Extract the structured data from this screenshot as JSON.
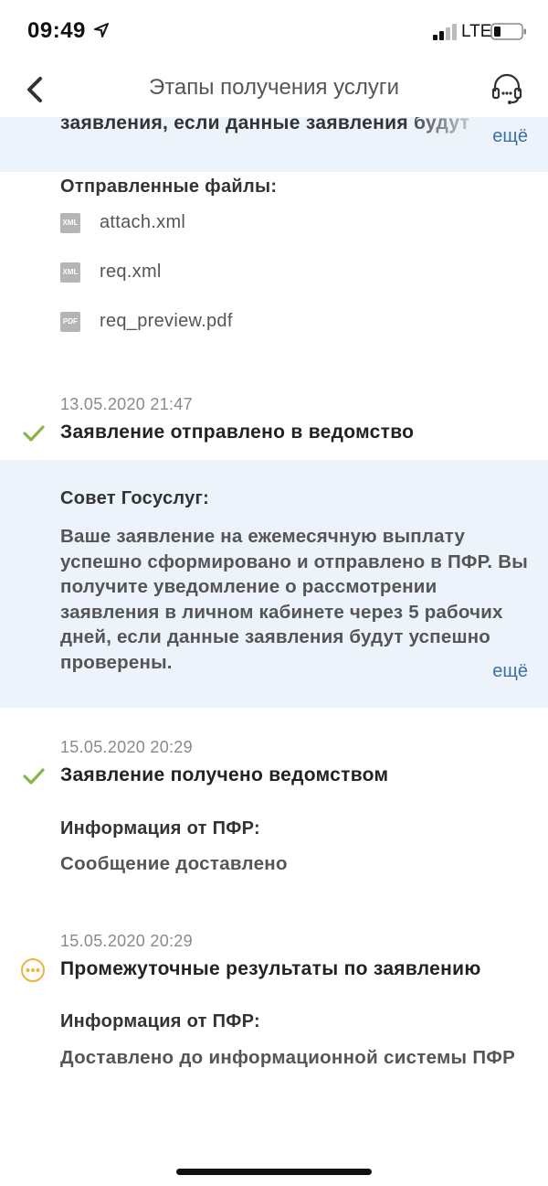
{
  "status_bar": {
    "time": "09:49",
    "network": "LTE"
  },
  "nav": {
    "title": "Этапы получения услуги",
    "back_icon": "chevron-left-icon",
    "support_icon": "headset-icon"
  },
  "top_panel": {
    "text": "заявления, если данные заявления будут",
    "more": "ещё"
  },
  "sent_files": {
    "label": "Отправленные файлы:",
    "files": [
      {
        "type": "XML",
        "name": "attach.xml"
      },
      {
        "type": "XML",
        "name": "req.xml"
      },
      {
        "type": "PDF",
        "name": "req_preview.pdf"
      }
    ]
  },
  "steps": [
    {
      "date": "13.05.2020 21:47",
      "title": "Заявление отправлено в ведомство",
      "status_icon": "check-icon"
    },
    {
      "date": "15.05.2020 20:29",
      "title": "Заявление получено ведомством",
      "status_icon": "check-icon",
      "info_label": "Информация от ПФР:",
      "info_text": "Сообщение доставлено"
    },
    {
      "date": "15.05.2020 20:29",
      "title": "Промежуточные результаты по заявлению",
      "status_icon": "in-progress-icon",
      "info_label": "Информация от ПФР:",
      "info_text": "Доставлено до информационной системы ПФР"
    }
  ],
  "advice": {
    "label": "Совет Госуслуг:",
    "text": "Ваше заявление на ежемесячную выплату успешно сформировано и отправлено в ПФР. Вы получите уведомление о рассмотрении заявления в личном кабинете через 5 рабочих дней, если данные заявления будут успешно проверены.",
    "more": "ещё"
  },
  "colors": {
    "accent_link": "#3a6fa8",
    "check_green": "#8ab34a",
    "progress_orange": "#f0b43c",
    "panel_bg": "#edf3fa"
  }
}
